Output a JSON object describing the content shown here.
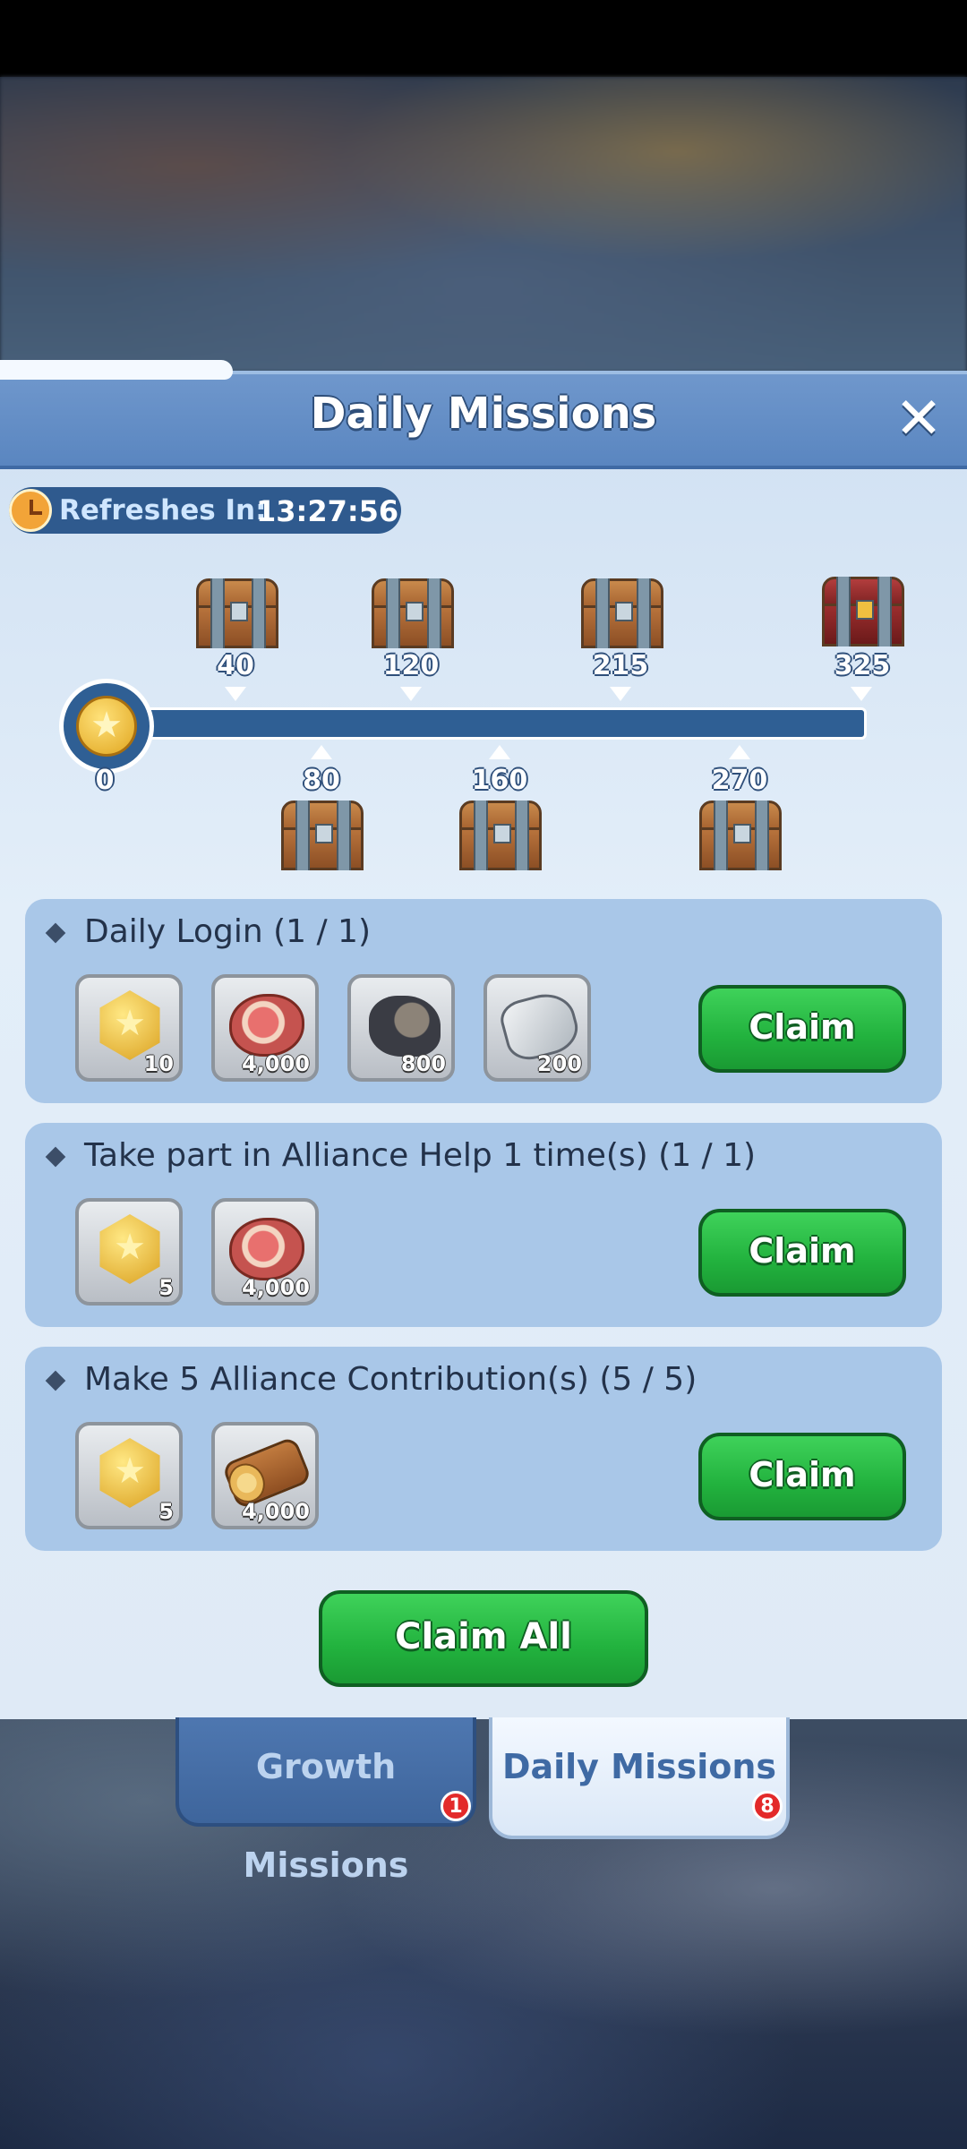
{
  "header": {
    "title": "Daily Missions",
    "close_icon": "close-icon"
  },
  "refresh": {
    "label": "Refreshes In:",
    "time": "13:27:56"
  },
  "progress": {
    "current": "0",
    "milestones_top": [
      "40",
      "120",
      "215",
      "325"
    ],
    "milestones_bottom": [
      "80",
      "160",
      "270"
    ]
  },
  "missions": [
    {
      "title": "Daily Login (1 / 1)",
      "rewards": [
        "10",
        "4,000",
        "800",
        "200"
      ],
      "button": "Claim"
    },
    {
      "title": "Take part in Alliance Help 1 time(s) (1 / 1)",
      "rewards": [
        "5",
        "4,000"
      ],
      "button": "Claim"
    },
    {
      "title": "Make 5 Alliance Contribution(s) (5 / 5)",
      "rewards": [
        "5",
        "4,000"
      ],
      "button": "Claim"
    }
  ],
  "claim_all": "Claim All",
  "tabs": [
    {
      "label": "Growth Missions",
      "badge": "1"
    },
    {
      "label": "Daily Missions",
      "badge": "8"
    }
  ],
  "colors": {
    "claim_green": "#22b23e",
    "header_blue": "#5a86c0",
    "badge_red": "#e32a2a"
  }
}
